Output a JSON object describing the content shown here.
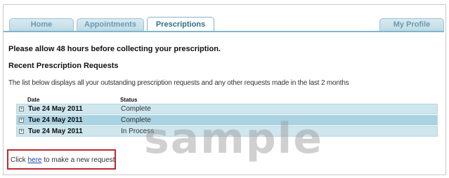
{
  "tabs": [
    {
      "label": "Home",
      "active": false
    },
    {
      "label": "Appointments",
      "active": false
    },
    {
      "label": "Prescriptions",
      "active": true
    },
    {
      "label": "My Profile",
      "active": false
    }
  ],
  "notice": "Please allow 48 hours before collecting your prescription.",
  "section_title": "Recent Prescription Requests",
  "description": "The list below displays all your outstanding prescription requests and any other requests made in the last 2 months",
  "table": {
    "columns": [
      "Date",
      "Status"
    ],
    "rows": [
      {
        "expand": "+",
        "date": "Tue 24 May 2011",
        "status": "Complete"
      },
      {
        "expand": "+",
        "date": "Tue 24 May 2011",
        "status": "Complete"
      },
      {
        "expand": "+",
        "date": "Tue 24 May 2011",
        "status": "In Process"
      }
    ]
  },
  "request": {
    "prefix": "Click ",
    "link_text": "here",
    "suffix": " to make a new request"
  },
  "watermark": "sample",
  "colors": {
    "tab_border": "#7fb6cc",
    "row_light": "#cfe6ee",
    "row_dark": "#a9d3e1",
    "highlight_box": "#c0282d",
    "link": "#1a3fbf"
  }
}
